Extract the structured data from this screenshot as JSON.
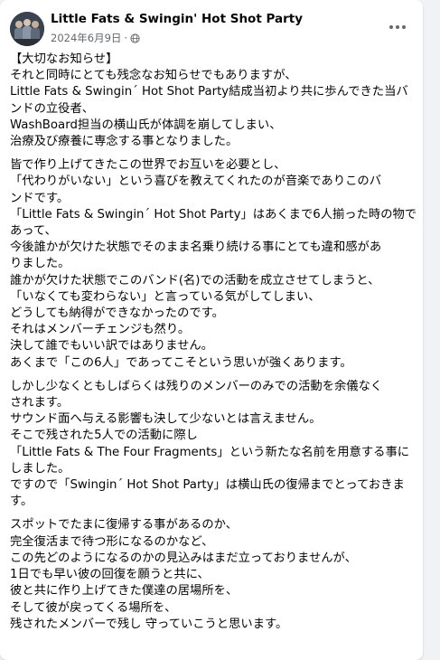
{
  "post": {
    "page_name": "Little Fats & Swingin' Hot Shot Party",
    "date": "2024年6月9日",
    "separator": "·",
    "visibility_icon": "globe-icon",
    "more_icon": "more-options-icon",
    "paragraphs": [
      [
        "【大切なお知らせ】",
        "それと同時にとても残念なお知らせでもありますが、",
        "Little Fats & Swingin´ Hot Shot Party結成当初より共に歩んできた当バ",
        "ンドの立役者、",
        "WashBoard担当の横山氏が体調を崩してしまい、",
        "治療及び療養に専念する事となりました。"
      ],
      [
        "皆で作り上げてきたこの世界でお互いを必要とし、",
        "「代わりがいない」という喜びを教えてくれたのが音楽でありこのバ",
        "ンドです。",
        "「Little Fats & Swingin´ Hot Shot Party」はあくまで6人揃った時の物で",
        "あって、",
        "今後誰かが欠けた状態でそのまま名乗り続ける事にとても違和感があ",
        "りました。",
        "誰かが欠けた状態でこのバンド(名)での活動を成立させてしまうと、",
        "「いなくても変わらない」と言っている気がしてしまい、",
        "どうしても納得ができなかったのです。",
        "それはメンバーチェンジも然り。",
        "決して誰でもいい訳ではありません。",
        "あくまで「この6人」であってこそという思いが強くあります。"
      ],
      [
        "しかし少なくともしばらくは残りのメンバーのみでの活動を余儀なく",
        "されます。",
        "サウンド面へ与える影響も決して少ないとは言えません。",
        "そこで残された5人での活動に際し",
        "「Little Fats & The Four Fragments」という新たな名前を用意する事に",
        "しました。",
        "ですので「Swingin´ Hot Shot Party」は横山氏の復帰までとっておきま",
        "す。"
      ],
      [
        "スポットでたまに復帰する事があるのか、",
        "完全復活まで待つ形になるのかなど、",
        "この先どのようになるのかの見込みはまだ立っておりませんが、",
        "1日でも早い彼の回復を願うと共に、",
        "彼と共に作り上げてきた僕達の居場所を、",
        "そして彼が戻ってくる場所を、",
        "残されたメンバーで残し 守っていこうと思います。"
      ]
    ]
  }
}
